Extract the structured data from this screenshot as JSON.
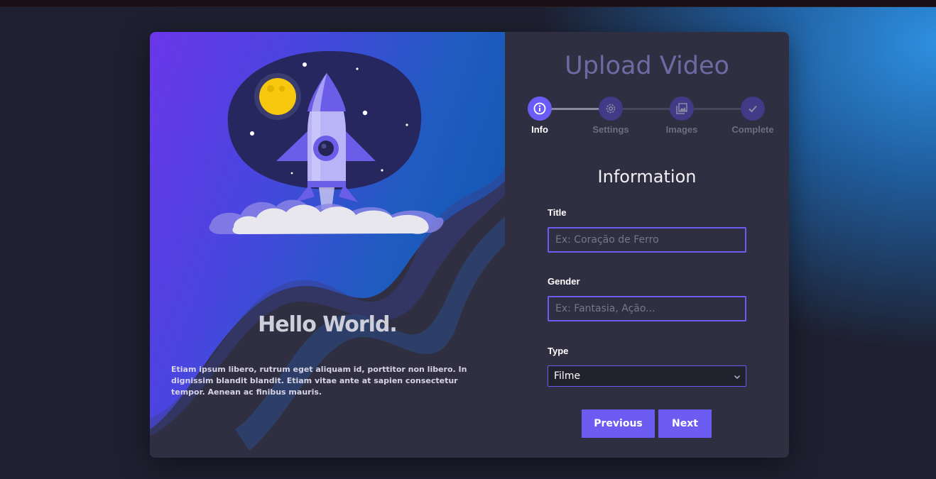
{
  "hero": {
    "heading": "Hello World.",
    "description": "Etiam ipsum libero, rutrum eget aliquam id, porttitor non libero. In dignissim blandit blandit. Etiam vitae ante at sapien consectetur tempor. Aenean ac finibus mauris."
  },
  "form": {
    "title": "Upload Video",
    "section_title": "Information",
    "steps": [
      {
        "label": "Info",
        "icon": "info-icon",
        "active": true
      },
      {
        "label": "Settings",
        "icon": "gear-icon",
        "active": false
      },
      {
        "label": "Images",
        "icon": "images-icon",
        "active": false
      },
      {
        "label": "Complete",
        "icon": "check-icon",
        "active": false
      }
    ],
    "fields": {
      "title": {
        "label": "Title",
        "placeholder": "Ex: Coração de Ferro",
        "value": ""
      },
      "gender": {
        "label": "Gender",
        "placeholder": "Ex: Fantasia, Ação...",
        "value": ""
      },
      "type": {
        "label": "Type",
        "selected": "Filme"
      }
    },
    "buttons": {
      "previous": "Previous",
      "next": "Next"
    }
  },
  "colors": {
    "accent": "#6d5cf2",
    "panel": "#2f2f41",
    "title": "#6f6aa4"
  }
}
